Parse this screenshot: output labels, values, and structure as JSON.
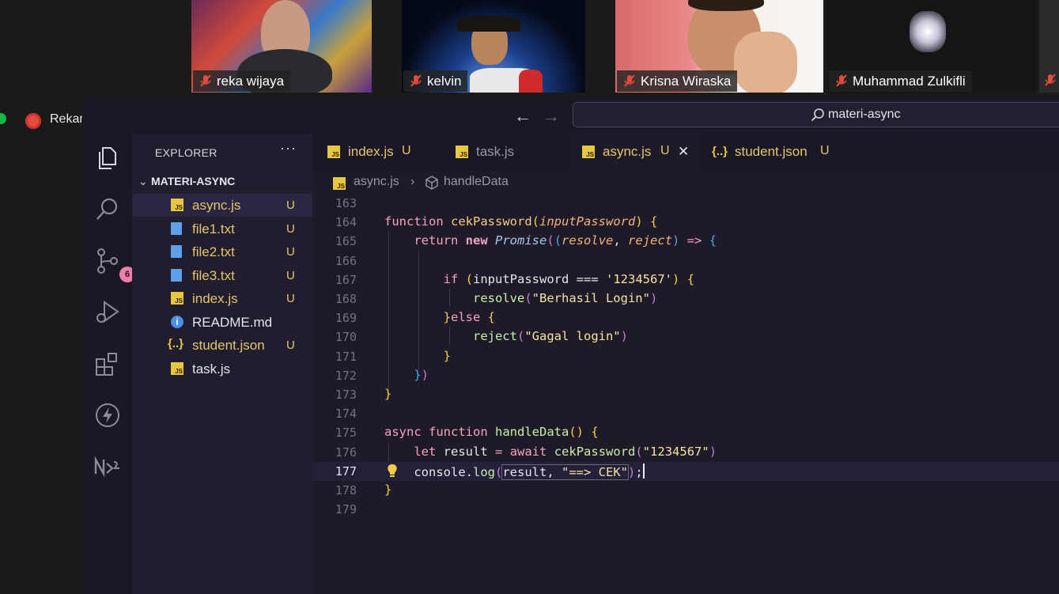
{
  "meeting": {
    "participants": [
      {
        "name": "reka wijaya"
      },
      {
        "name": "kelvin"
      },
      {
        "name": "Krisna Wiraska"
      },
      {
        "name": "Muhammad Zulkifli"
      }
    ],
    "recording_label": "Rekaman"
  },
  "vscode": {
    "search_text": "materi-async",
    "explorer_title": "EXPLORER",
    "explorer_menu": "···",
    "folder_name": "MATERI-ASYNC",
    "scm_badge": "6",
    "files": [
      {
        "name": "async.js",
        "status": "U",
        "icon": "js-icon"
      },
      {
        "name": "file1.txt",
        "status": "U",
        "icon": "text-file-icon"
      },
      {
        "name": "file2.txt",
        "status": "U",
        "icon": "text-file-icon"
      },
      {
        "name": "file3.txt",
        "status": "U",
        "icon": "text-file-icon"
      },
      {
        "name": "index.js",
        "status": "U",
        "icon": "js-icon"
      },
      {
        "name": "README.md",
        "status": "",
        "icon": "info-icon"
      },
      {
        "name": "student.json",
        "status": "U",
        "icon": "json-icon"
      },
      {
        "name": "task.js",
        "status": "",
        "icon": "js-icon"
      }
    ],
    "tabs": [
      {
        "name": "index.js",
        "status": "U"
      },
      {
        "name": "task.js",
        "status": ""
      },
      {
        "name": "async.js",
        "status": "U"
      },
      {
        "name": "student.json",
        "status": "U"
      }
    ],
    "breadcrumb": {
      "file": "async.js",
      "symbol": "handleData"
    },
    "line_numbers": [
      "163",
      "164",
      "165",
      "166",
      "167",
      "168",
      "169",
      "170",
      "171",
      "172",
      "173",
      "174",
      "175",
      "176",
      "177",
      "178",
      "179"
    ],
    "code": {
      "l164": {
        "kw": "function",
        "name": "cekPassword",
        "param": "inputPassword"
      },
      "l165": {
        "kw1": "return",
        "kw2": "new",
        "cls": "Promise",
        "p1": "resolve",
        "p2": "reject"
      },
      "l167": {
        "kw": "if",
        "cond": "inputPassword === ",
        "str": "'1234567'"
      },
      "l168": {
        "fn": "resolve",
        "str": "\"Berhasil Login\""
      },
      "l169": {
        "kw": "else"
      },
      "l170": {
        "fn": "reject",
        "str": "\"Gagal login\""
      },
      "l175": {
        "kw1": "async",
        "kw2": "function",
        "name": "handleData"
      },
      "l176": {
        "kw1": "let",
        "var": "result",
        "kw2": "await",
        "fn": "cekPassword",
        "str": "\"1234567\""
      },
      "l177": {
        "obj": "console",
        "fn": "log",
        "arg": "result",
        "str": "\"==> CEK\""
      }
    },
    "colors": {
      "accent": "#f3a3c4",
      "modified": "#e3c86a",
      "js_icon": "#e8c73e"
    }
  }
}
